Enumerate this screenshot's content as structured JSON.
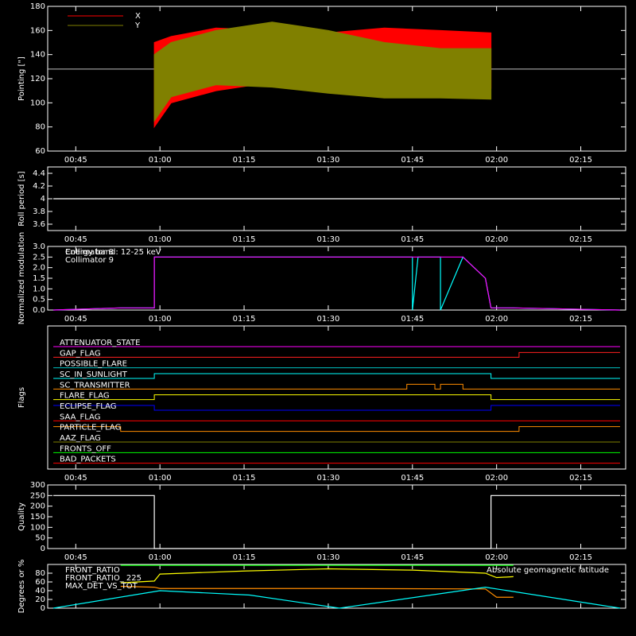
{
  "time_ticks": [
    "00:45",
    "01:00",
    "01:15",
    "01:30",
    "01:45",
    "02:00",
    "02:15"
  ],
  "time_range": [
    "00:40",
    "02:23"
  ],
  "chart_data": [
    {
      "type": "line",
      "ylabel": "Pointing [\"]",
      "ylim": [
        60,
        180
      ],
      "yticks": [
        60,
        80,
        100,
        120,
        140,
        160,
        180
      ],
      "reference_value": 128,
      "legend": [
        {
          "name": "X",
          "color": "#ff0000"
        },
        {
          "name": "Y",
          "color": "#808000"
        }
      ],
      "series": [
        {
          "name": "X",
          "color": "#ff0000",
          "t": [
            "00:59",
            "01:02",
            "01:10",
            "01:20",
            "01:30",
            "01:40",
            "01:50",
            "01:59"
          ],
          "upper": [
            150,
            155,
            162,
            160,
            158,
            162,
            160,
            158
          ],
          "lower": [
            80,
            100,
            110,
            117,
            110,
            108,
            110,
            112
          ]
        },
        {
          "name": "Y",
          "color": "#808000",
          "t": [
            "00:59",
            "01:02",
            "01:10",
            "01:20",
            "01:30",
            "01:40",
            "01:50",
            "01:59"
          ],
          "upper": [
            140,
            150,
            160,
            167,
            160,
            150,
            145,
            145
          ],
          "lower": [
            85,
            105,
            115,
            113,
            108,
            104,
            104,
            103
          ]
        }
      ]
    },
    {
      "type": "line",
      "ylabel": "Roll period [s]",
      "ylim": [
        3.5,
        4.5
      ],
      "yticks": [
        3.6,
        3.8,
        4.0,
        4.2,
        4.4
      ],
      "series": [
        {
          "color": "#ffffff",
          "t": [
            "00:41",
            "02:22"
          ],
          "y": [
            4.0,
            4.0
          ]
        }
      ]
    },
    {
      "type": "line",
      "ylabel": "Normalized modulation",
      "ylim": [
        0,
        3
      ],
      "yticks": [
        0.0,
        0.5,
        1.0,
        1.5,
        2.0,
        2.5,
        3.0
      ],
      "annotation": "Energy band: 12-25 keV",
      "legend": [
        {
          "name": "Collimator 8",
          "color": "#00ffff"
        },
        {
          "name": "Collimator 9",
          "color": "#ff00ff"
        }
      ],
      "series": [
        {
          "name": "Collimator 8",
          "color": "#00ffff",
          "t": [
            "00:41",
            "00:53",
            "00:59",
            "00:59",
            "01:45",
            "01:45",
            "01:46",
            "01:50",
            "01:50",
            "01:54",
            "01:58",
            "01:59",
            "02:03",
            "02:22"
          ],
          "y": [
            0,
            0.1,
            0.1,
            2.5,
            2.5,
            0,
            2.5,
            2.5,
            0,
            2.5,
            1.5,
            0.1,
            0.1,
            0
          ]
        },
        {
          "name": "Collimator 9",
          "color": "#ff00ff",
          "t": [
            "00:41",
            "00:53",
            "00:59",
            "00:59",
            "01:54",
            "01:58",
            "01:59",
            "02:03",
            "02:22"
          ],
          "y": [
            0,
            0.1,
            0.1,
            2.5,
            2.5,
            1.5,
            0.1,
            0.1,
            0
          ]
        }
      ]
    },
    {
      "type": "line",
      "ylabel": "Flags",
      "flags": [
        {
          "name": "ATTENUATOR_STATE",
          "color": "#ff00ff",
          "t": [
            "00:41",
            "02:22"
          ],
          "v": [
            0,
            0
          ]
        },
        {
          "name": "GAP_FLAG",
          "color": "#ff2020",
          "t": [
            "00:41",
            "02:04",
            "02:04",
            "02:22"
          ],
          "v": [
            0,
            0,
            1,
            1
          ]
        },
        {
          "name": "POSSIBLE_FLARE",
          "color": "#00c0c0",
          "t": [
            "00:41",
            "02:22"
          ],
          "v": [
            0,
            0
          ]
        },
        {
          "name": "SC_IN_SUNLIGHT",
          "color": "#00ffff",
          "t": [
            "00:41",
            "00:59",
            "00:59",
            "01:59",
            "01:59",
            "02:22"
          ],
          "v": [
            0,
            0,
            1,
            1,
            0,
            0
          ]
        },
        {
          "name": "SC_TRANSMITTER",
          "color": "#ff8c00",
          "t": [
            "00:41",
            "01:44",
            "01:44",
            "01:49",
            "01:49",
            "01:50",
            "01:50",
            "01:54",
            "01:54",
            "02:22"
          ],
          "v": [
            0,
            0,
            1,
            1,
            0,
            0,
            1,
            1,
            0,
            0
          ]
        },
        {
          "name": "FLARE_FLAG",
          "color": "#ffff00",
          "t": [
            "00:41",
            "00:59",
            "00:59",
            "01:59",
            "01:59",
            "02:22"
          ],
          "v": [
            0,
            0,
            1,
            1,
            0,
            0
          ]
        },
        {
          "name": "ECLIPSE_FLAG",
          "color": "#0000ff",
          "t": [
            "00:41",
            "00:59",
            "00:59",
            "01:59",
            "01:59",
            "02:22"
          ],
          "v": [
            1,
            1,
            0,
            0,
            1,
            1
          ]
        },
        {
          "name": "SAA_FLAG",
          "color": "#ff0000",
          "t": [
            "00:41",
            "02:22"
          ],
          "v": [
            0,
            0
          ]
        },
        {
          "name": "PARTICLE_FLAG",
          "color": "#ff8c00",
          "t": [
            "00:41",
            "00:53",
            "00:53",
            "02:04",
            "02:04",
            "02:22"
          ],
          "v": [
            1,
            1,
            0,
            0,
            1,
            1
          ]
        },
        {
          "name": "AAZ_FLAG",
          "color": "#808000",
          "t": [
            "00:41",
            "02:22"
          ],
          "v": [
            0,
            0
          ]
        },
        {
          "name": "FRONTS_OFF",
          "color": "#00ff00",
          "t": [
            "00:41",
            "02:22"
          ],
          "v": [
            0,
            0
          ]
        },
        {
          "name": "BAD_PACKETS",
          "color": "#ff0000",
          "t": [
            "00:41",
            "02:22"
          ],
          "v": [
            0,
            0
          ]
        }
      ]
    },
    {
      "type": "line",
      "ylabel": "Quality",
      "ylim": [
        0,
        300
      ],
      "yticks": [
        0,
        50,
        100,
        150,
        200,
        250,
        300
      ],
      "series": [
        {
          "color": "#ffffff",
          "t": [
            "00:41",
            "00:59",
            "00:59",
            "01:59",
            "01:59",
            "02:22"
          ],
          "y": [
            250,
            250,
            0,
            0,
            250,
            250
          ]
        }
      ]
    },
    {
      "type": "line",
      "ylabel": "Degrees or %",
      "ylim": [
        0,
        100
      ],
      "yticks": [
        0,
        20,
        40,
        60,
        80
      ],
      "right_annotation": "Absolute geomagnetic latitude",
      "legend": [
        {
          "name": "FRONT_RATIO",
          "color": "#ffff00"
        },
        {
          "name": "FRONT_RATIO_ 225",
          "color": "#00ff00"
        },
        {
          "name": "MAX_DET_VS_TOT",
          "color": "#ff8c00"
        }
      ],
      "series": [
        {
          "name": "FRONT_RATIO",
          "color": "#ffff00",
          "t": [
            "00:53",
            "00:59",
            "01:00",
            "01:15",
            "01:30",
            "01:45",
            "01:58",
            "02:00",
            "02:03"
          ],
          "y": [
            58,
            62,
            78,
            85,
            90,
            87,
            80,
            70,
            72
          ]
        },
        {
          "name": "FRONT_RATIO_ 225",
          "color": "#00ff00",
          "t": [
            "00:53",
            "02:03"
          ],
          "y": [
            98,
            98
          ]
        },
        {
          "name": "MAX_DET_VS_TOT",
          "color": "#ff8c00",
          "t": [
            "00:53",
            "00:59",
            "01:00",
            "01:30",
            "01:58",
            "02:00",
            "02:03"
          ],
          "y": [
            50,
            48,
            45,
            45,
            44,
            25,
            25
          ]
        },
        {
          "name": "Absolute geomagnetic latitude",
          "color": "#00ffff",
          "t": [
            "00:41",
            "01:00",
            "01:16",
            "01:32",
            "01:58",
            "02:22"
          ],
          "y": [
            0,
            40,
            30,
            0,
            48,
            0
          ]
        }
      ]
    }
  ]
}
